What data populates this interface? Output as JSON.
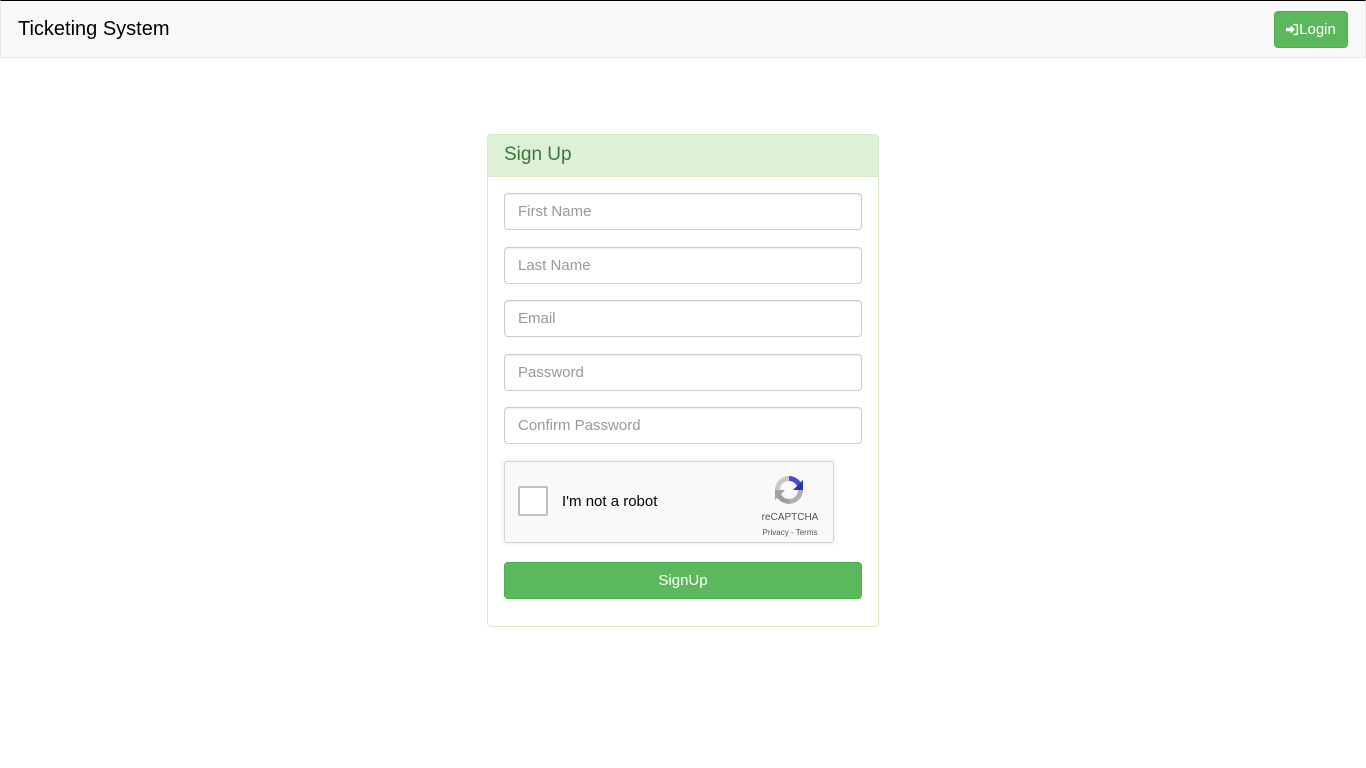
{
  "navbar": {
    "brand": "Ticketing System",
    "login_label": "Login",
    "login_icon": "sign-in-icon"
  },
  "panel": {
    "title": "Sign Up"
  },
  "form": {
    "first_name": {
      "placeholder": "First Name",
      "value": ""
    },
    "last_name": {
      "placeholder": "Last Name",
      "value": ""
    },
    "email": {
      "placeholder": "Email",
      "value": ""
    },
    "password": {
      "placeholder": "Password",
      "value": ""
    },
    "confirm_password": {
      "placeholder": "Confirm Password",
      "value": ""
    },
    "submit_label": "SignUp"
  },
  "recaptcha": {
    "label": "I'm not a robot",
    "brand": "reCAPTCHA",
    "privacy": "Privacy",
    "separator": " - ",
    "terms": "Terms",
    "checked": false
  },
  "colors": {
    "primary_green": "#5cb85c",
    "panel_heading_bg": "#dff0d8",
    "panel_heading_text": "#3c763d",
    "navbar_bg": "#f8f8f8"
  }
}
